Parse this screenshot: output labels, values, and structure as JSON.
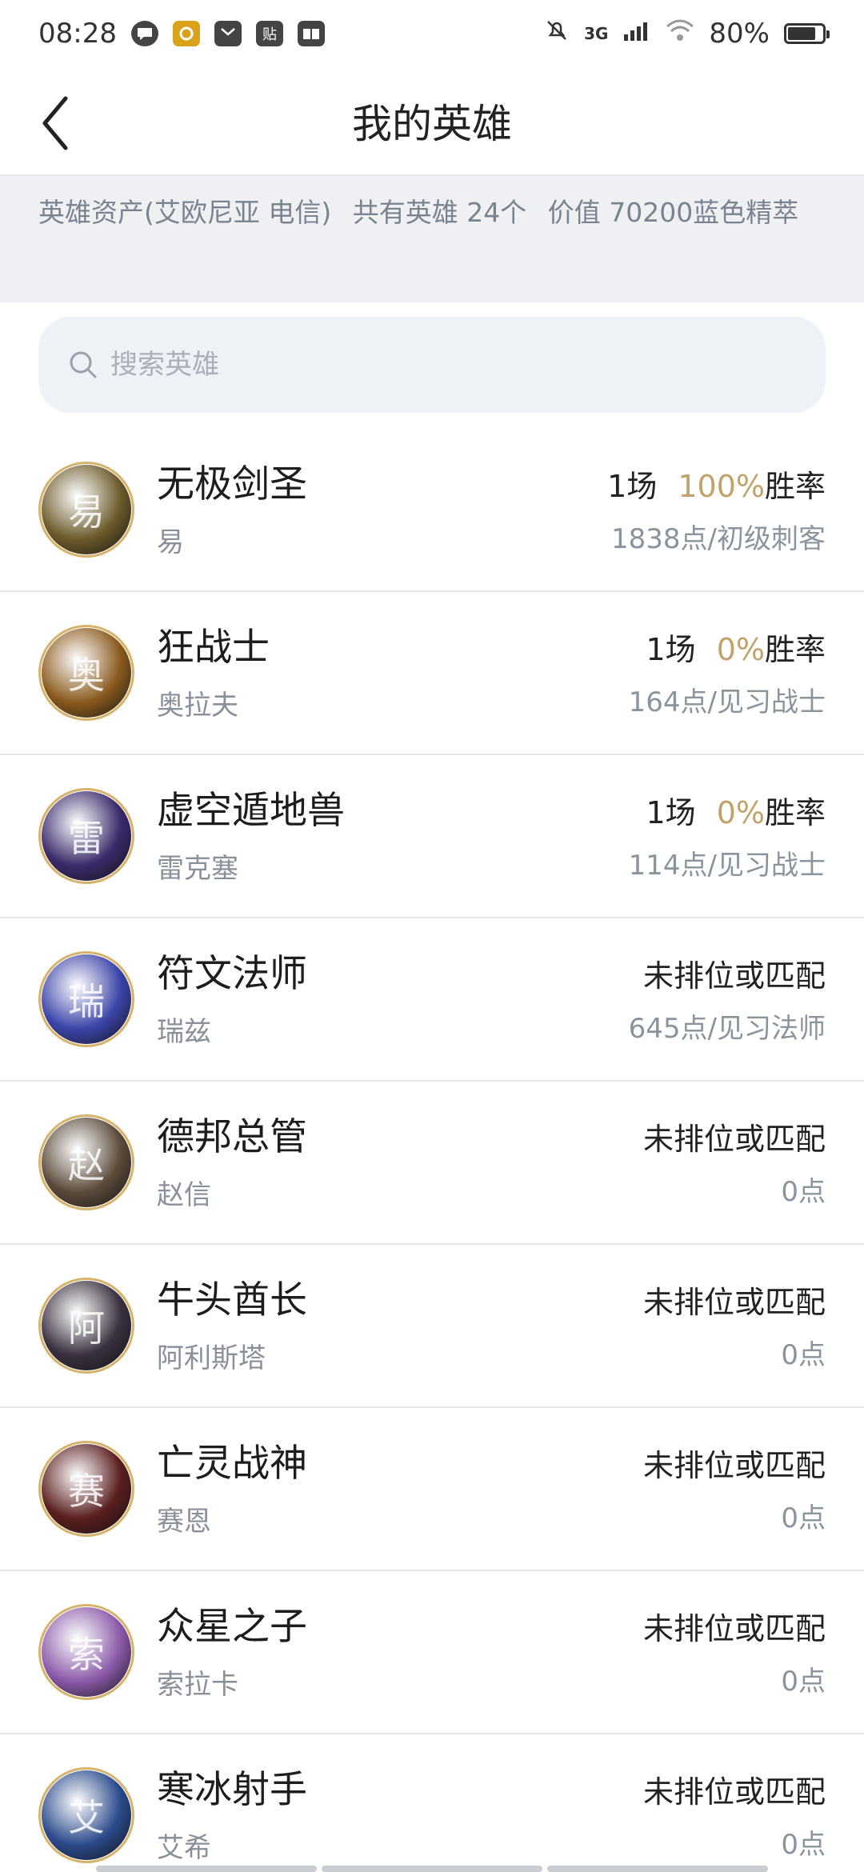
{
  "status_bar": {
    "time": "08:28",
    "network": "3G",
    "battery": "80%",
    "battery_level": 0.8,
    "app_icons": [
      "chat-bubble-icon",
      "game-icon",
      "mail-icon",
      "tieba-icon",
      "book-icon"
    ],
    "tieba_char": "贴"
  },
  "nav": {
    "title": "我的英雄"
  },
  "summary": {
    "assets": "英雄资产(艾欧尼亚 电信)",
    "count": "共有英雄 24个",
    "value": "价值 70200蓝色精萃"
  },
  "search": {
    "placeholder": "搜索英雄"
  },
  "heroes": [
    {
      "title": "无极剑圣",
      "name": "易",
      "games": "1场",
      "rate": "100%",
      "rate_label": "胜率",
      "points": "1838点/初级刺客",
      "initial": "易",
      "color": "#6b5a2a"
    },
    {
      "title": "狂战士",
      "name": "奥拉夫",
      "games": "1场",
      "rate": "0%",
      "rate_label": "胜率",
      "points": "164点/见习战士",
      "initial": "奥",
      "color": "#8a5a1e"
    },
    {
      "title": "虚空遁地兽",
      "name": "雷克塞",
      "games": "1场",
      "rate": "0%",
      "rate_label": "胜率",
      "points": "114点/见习战士",
      "initial": "雷",
      "color": "#3a2a6a"
    },
    {
      "title": "符文法师",
      "name": "瑞兹",
      "unranked": "未排位或匹配",
      "points": "645点/见习法师",
      "initial": "瑞",
      "color": "#3b44a8"
    },
    {
      "title": "德邦总管",
      "name": "赵信",
      "unranked": "未排位或匹配",
      "points": "0点",
      "initial": "赵",
      "color": "#5b4a3a"
    },
    {
      "title": "牛头酋长",
      "name": "阿利斯塔",
      "unranked": "未排位或匹配",
      "points": "0点",
      "initial": "阿",
      "color": "#3a3040"
    },
    {
      "title": "亡灵战神",
      "name": "赛恩",
      "unranked": "未排位或匹配",
      "points": "0点",
      "initial": "赛",
      "color": "#5a1e1e"
    },
    {
      "title": "众星之子",
      "name": "索拉卡",
      "unranked": "未排位或匹配",
      "points": "0点",
      "initial": "索",
      "color": "#8a5aa8"
    },
    {
      "title": "寒冰射手",
      "name": "艾希",
      "unranked": "未排位或匹配",
      "points": "0点",
      "initial": "艾",
      "color": "#2a4a8a"
    }
  ]
}
